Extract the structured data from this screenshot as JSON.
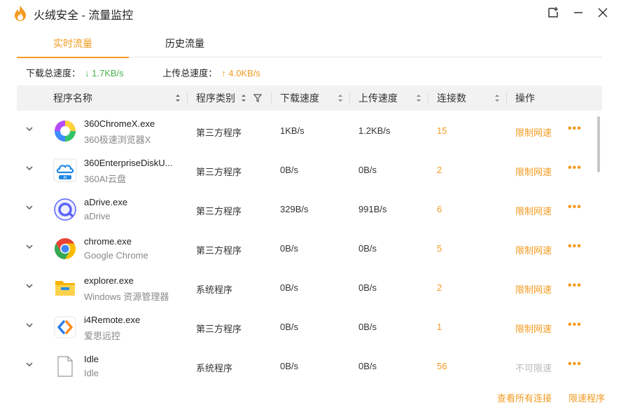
{
  "window": {
    "title": "火绒安全 - 流量监控"
  },
  "colors": {
    "accent": "#f29a1f",
    "download": "#4caf50",
    "disabled": "#bbbbbb"
  },
  "tabs": [
    {
      "label": "实时流量",
      "active": true
    },
    {
      "label": "历史流量",
      "active": false
    }
  ],
  "summary": {
    "download_label": "下载总速度：",
    "download_value": "↓ 1.7KB/s",
    "upload_label": "上传总速度：",
    "upload_value": "↑ 4.0KB/s"
  },
  "columns": {
    "name": "程序名称",
    "type": "程序类别",
    "down": "下载速度",
    "up": "上传速度",
    "conn": "连接数",
    "action": "操作"
  },
  "rows": [
    {
      "name": "360ChromeX.exe",
      "desc": "360极速浏览器X",
      "type": "第三方程序",
      "down": "1KB/s",
      "up": "1.2KB/s",
      "conn": "15",
      "action": "限制网速",
      "icon": "360-chrome-icon"
    },
    {
      "name": "360EnterpriseDiskU...",
      "desc": "360AI云盘",
      "type": "第三方程序",
      "down": "0B/s",
      "up": "0B/s",
      "conn": "2",
      "action": "限制网速",
      "icon": "360-cloud-disk-icon"
    },
    {
      "name": "aDrive.exe",
      "desc": "aDrive",
      "type": "第三方程序",
      "down": "329B/s",
      "up": "991B/s",
      "conn": "6",
      "action": "限制网速",
      "icon": "adrive-icon"
    },
    {
      "name": "chrome.exe",
      "desc": "Google Chrome",
      "type": "第三方程序",
      "down": "0B/s",
      "up": "0B/s",
      "conn": "5",
      "action": "限制网速",
      "icon": "chrome-icon"
    },
    {
      "name": "explorer.exe",
      "desc": "Windows 资源管理器",
      "type": "系统程序",
      "down": "0B/s",
      "up": "0B/s",
      "conn": "2",
      "action": "限制网速",
      "icon": "folder-icon"
    },
    {
      "name": "i4Remote.exe",
      "desc": "爱思远控",
      "type": "第三方程序",
      "down": "0B/s",
      "up": "0B/s",
      "conn": "1",
      "action": "限制网速",
      "icon": "i4remote-icon"
    },
    {
      "name": "Idle",
      "desc": "Idle",
      "type": "系统程序",
      "down": "0B/s",
      "up": "0B/s",
      "conn": "56",
      "action": "不可限速",
      "icon": "file-icon"
    }
  ],
  "footer": {
    "view_all": "查看所有连接",
    "limit_programs": "限速程序"
  }
}
